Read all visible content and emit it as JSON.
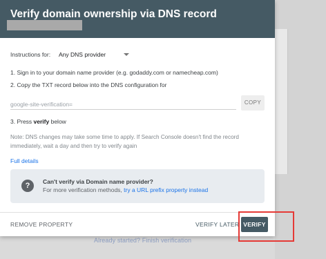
{
  "background": {
    "link_text": "Already started? Finish verification"
  },
  "dialog": {
    "title": "Verify domain ownership via DNS record",
    "instructions_label": "Instructions for:",
    "provider_selected": "Any DNS provider",
    "step1": "1. Sign in to your domain name provider (e.g. godaddy.com or namecheap.com)",
    "step2": "2. Copy the TXT record below into the DNS configuration for",
    "txt_record": "google-site-verification=",
    "copy_label": "COPY",
    "step3_prefix": "3. Press ",
    "step3_bold": "verify",
    "step3_suffix": " below",
    "note": "Note: DNS changes may take some time to apply. If Search Console doesn't find the record immediately, wait a day and then try to verify again",
    "full_details": "Full details",
    "info_title": "Can't verify via Domain name provider?",
    "info_prefix": "For more verification methods, ",
    "info_link": "try a URL prefix property instead",
    "remove_label": "REMOVE PROPERTY",
    "verify_later_label": "VERIFY LATER",
    "verify_label": "VERIFY"
  },
  "colors": {
    "header": "#455a64",
    "link": "#1a73e8",
    "highlight": "#e53935"
  }
}
